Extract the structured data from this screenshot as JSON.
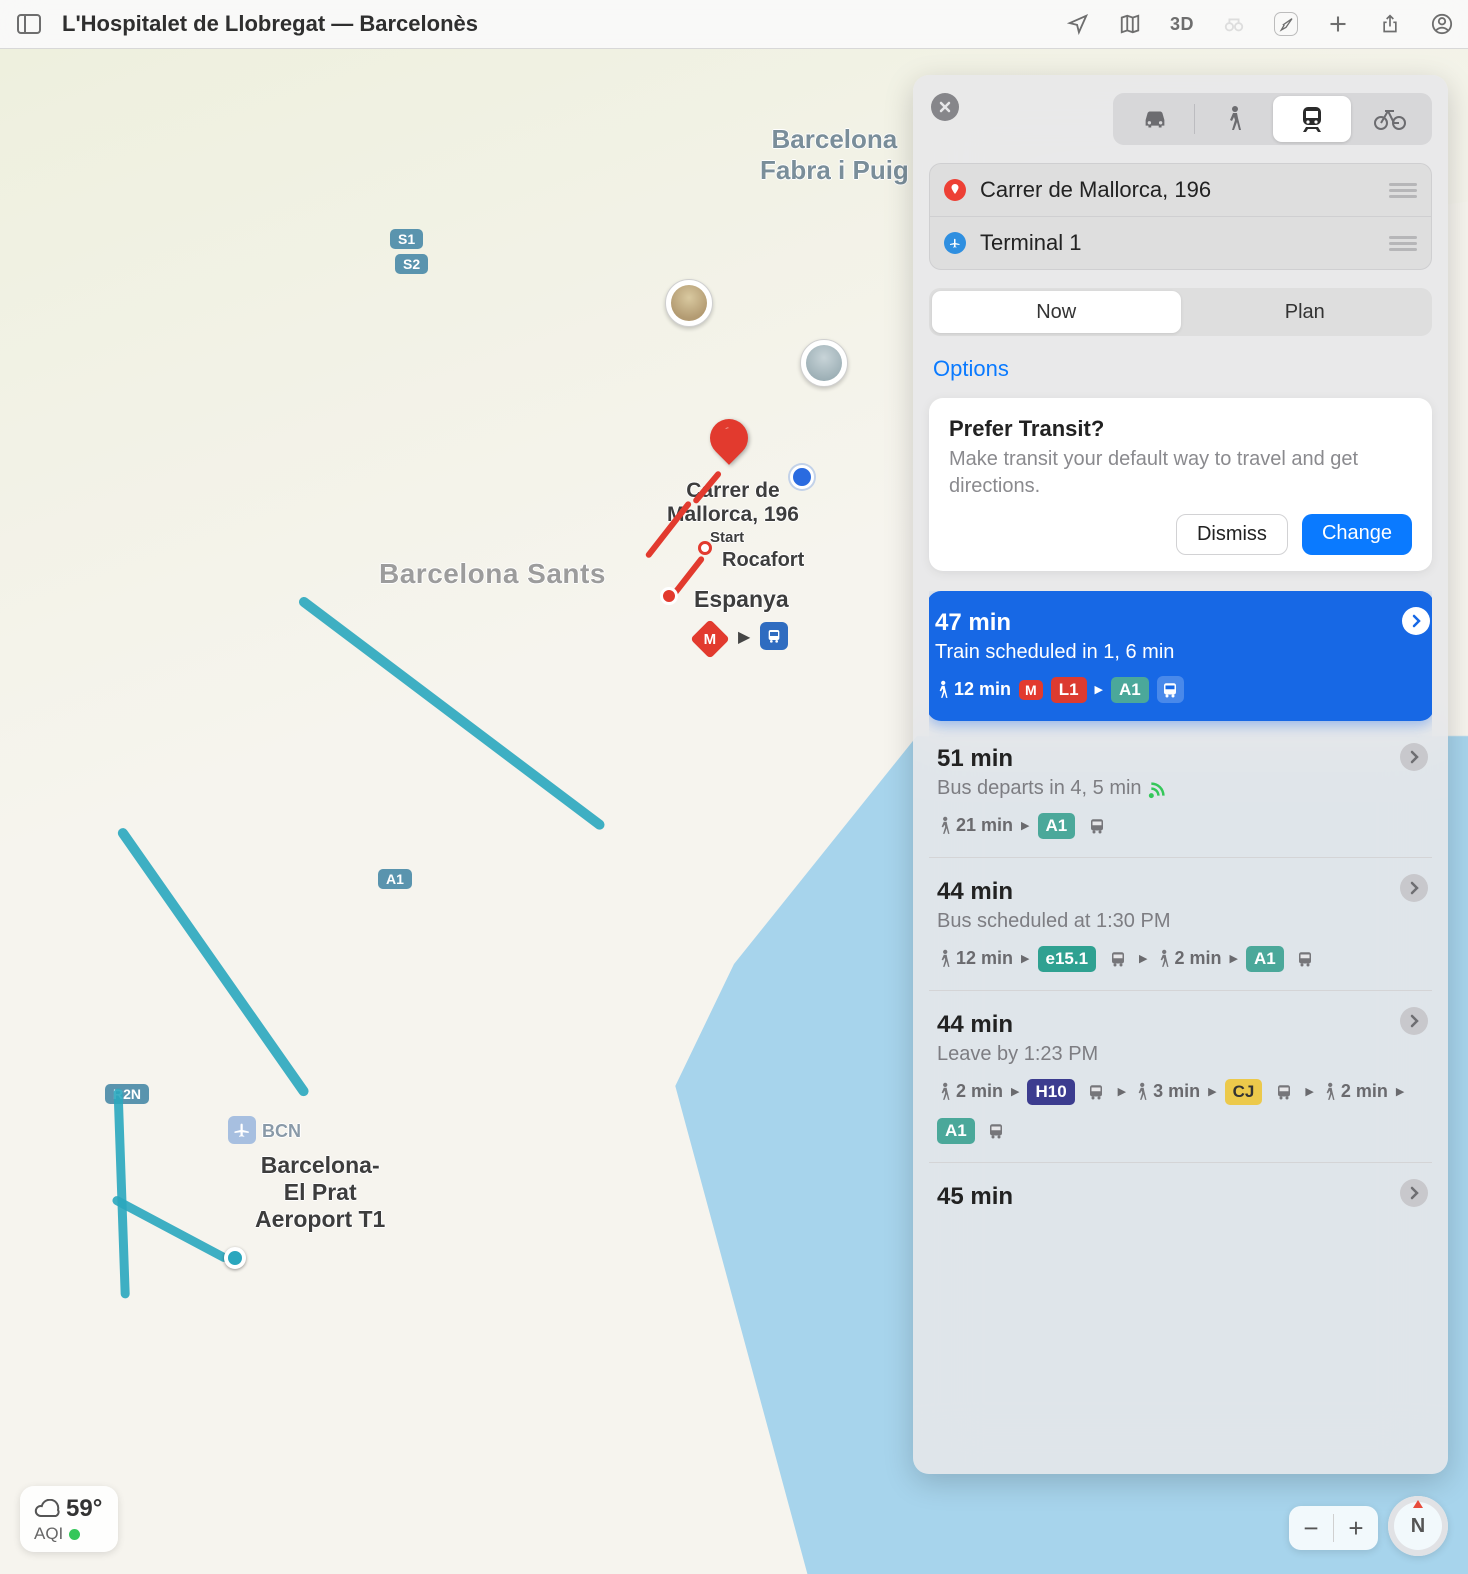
{
  "toolbar": {
    "title": "L'Hospitalet de Llobregat — Barcelonès",
    "mode3d": "3D",
    "tooltip": "Toggle sidebar"
  },
  "map": {
    "labels": {
      "fabra": "Barcelona\nFabra i Puig",
      "sants": "Barcelona Sants",
      "bcn_code": "BCN",
      "airport": "Barcelona-\nEl Prat\nAeroport T1",
      "origin_name": "Carrer de\nMallorca, 196",
      "start": "Start",
      "rocafort": "Rocafort",
      "espanya": "Espanya"
    },
    "shields": {
      "s1": "S1",
      "s2": "S2",
      "a1": "A1",
      "r2n": "R2N"
    },
    "transit_badges": {
      "metro": "M"
    }
  },
  "panel": {
    "stops": {
      "origin": "Carrer de Mallorca, 196",
      "dest": "Terminal 1"
    },
    "time_tabs": {
      "now": "Now",
      "plan": "Plan"
    },
    "options": "Options",
    "prefer": {
      "title": "Prefer Transit?",
      "body": "Make transit your default way to travel and get directions.",
      "dismiss": "Dismiss",
      "change": "Change"
    },
    "routes": [
      {
        "selected": true,
        "title": "47 min",
        "sub": "Train scheduled in 1, 6 min",
        "legs": [
          {
            "t": "walk",
            "v": "12 min"
          },
          {
            "t": "badge",
            "cls": "metroM",
            "v": "M"
          },
          {
            "t": "badge",
            "cls": "L1",
            "v": "L1"
          },
          {
            "t": "sep"
          },
          {
            "t": "badge",
            "cls": "A1",
            "v": "A1"
          },
          {
            "t": "vehicle",
            "mode": "bus",
            "style": "white"
          }
        ]
      },
      {
        "title": "51 min",
        "sub": "Bus departs in 4, 5 min",
        "live": true,
        "legs": [
          {
            "t": "walk",
            "v": "21 min"
          },
          {
            "t": "sep"
          },
          {
            "t": "badge",
            "cls": "A1",
            "v": "A1"
          },
          {
            "t": "vehicle",
            "mode": "bus",
            "style": "gray"
          }
        ]
      },
      {
        "title": "44 min",
        "sub": "Bus scheduled at 1:30 PM",
        "legs": [
          {
            "t": "walk",
            "v": "12 min"
          },
          {
            "t": "sep"
          },
          {
            "t": "badge",
            "cls": "e15",
            "v": "e15.1"
          },
          {
            "t": "vehicle",
            "mode": "bus",
            "style": "gray"
          },
          {
            "t": "sep"
          },
          {
            "t": "walk",
            "v": "2 min"
          },
          {
            "t": "sep"
          },
          {
            "t": "badge",
            "cls": "A1",
            "v": "A1"
          },
          {
            "t": "vehicle",
            "mode": "bus",
            "style": "gray"
          }
        ]
      },
      {
        "title": "44 min",
        "sub": "Leave by 1:23 PM",
        "legs": [
          {
            "t": "walk",
            "v": "2 min"
          },
          {
            "t": "sep"
          },
          {
            "t": "badge",
            "cls": "H10",
            "v": "H10"
          },
          {
            "t": "vehicle",
            "mode": "bus",
            "style": "gray"
          },
          {
            "t": "sep"
          },
          {
            "t": "walk",
            "v": "3 min"
          },
          {
            "t": "sep"
          },
          {
            "t": "badge",
            "cls": "CJ",
            "v": "CJ"
          },
          {
            "t": "vehicle",
            "mode": "bus",
            "style": "gray"
          },
          {
            "t": "sep"
          },
          {
            "t": "walk",
            "v": "2 min"
          },
          {
            "t": "sep"
          },
          {
            "t": "badge",
            "cls": "A1",
            "v": "A1"
          },
          {
            "t": "vehicle",
            "mode": "bus",
            "style": "gray"
          }
        ]
      },
      {
        "title": "45 min",
        "sub": "",
        "legs": []
      }
    ]
  },
  "weather": {
    "temp": "59°",
    "aqi": "AQI"
  },
  "compass": "N"
}
